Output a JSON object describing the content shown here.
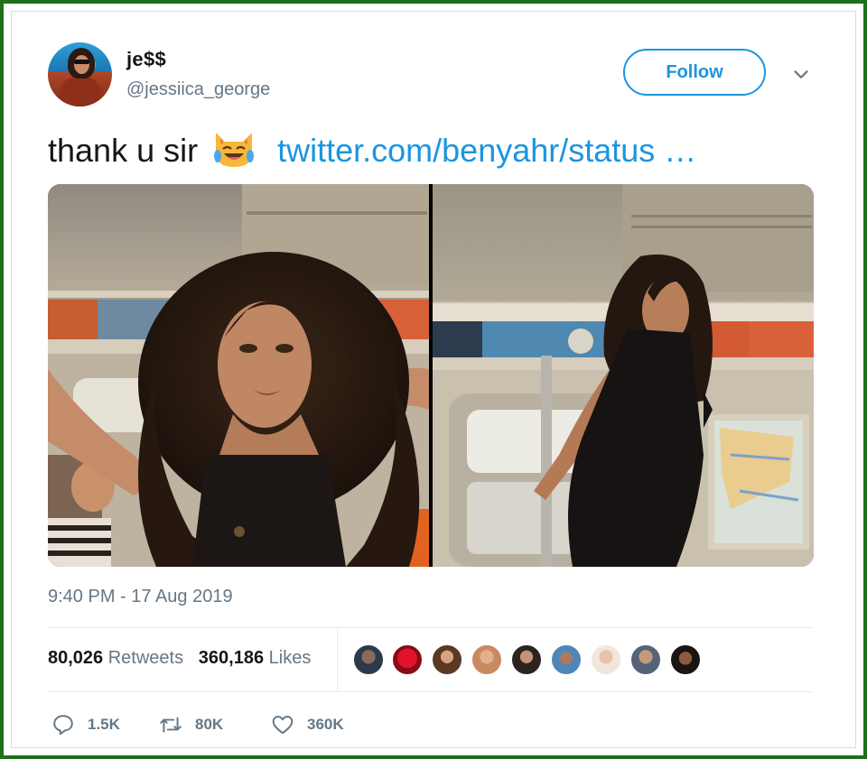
{
  "tweet": {
    "author": {
      "display_name": "je$$",
      "handle": "@jessiica_george"
    },
    "follow_label": "Follow",
    "text": "thank u sir",
    "emoji_name": "face-with-tears-of-joy",
    "link_text": "twitter.com/benyahr/status …",
    "timestamp": "9:40 PM - 17 Aug 2019",
    "stats": {
      "retweets_count": "80,026",
      "retweets_label": "Retweets",
      "likes_count": "360,186",
      "likes_label": "Likes"
    },
    "actions": {
      "replies": "1.5K",
      "retweets": "80K",
      "likes": "360K"
    },
    "colors": {
      "link": "#1b95e0",
      "secondary_text": "#657786",
      "frame_border": "#1f6f1c"
    }
  }
}
